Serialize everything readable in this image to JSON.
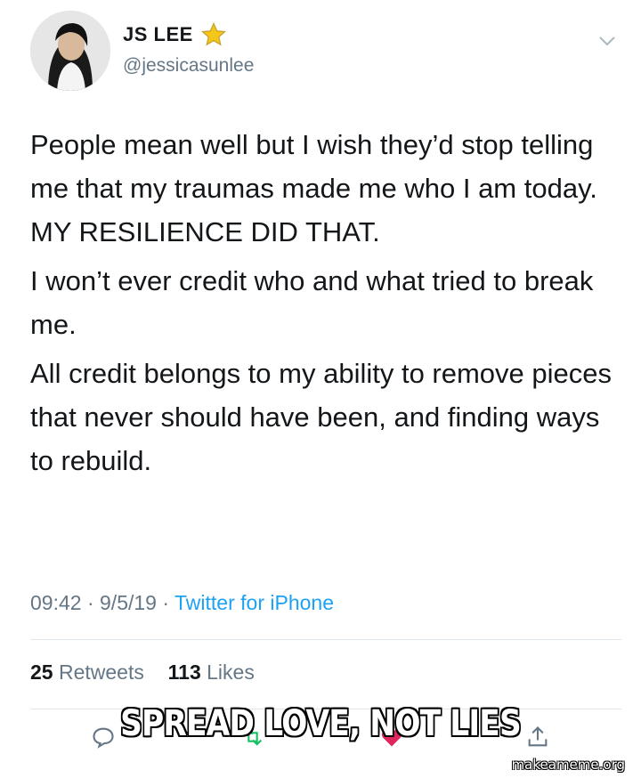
{
  "tweet": {
    "author": {
      "display_name": "JS LEE",
      "handle": "@jessicasunlee",
      "badge_icon": "star-icon",
      "avatar_icon": "avatar"
    },
    "menu_icon": "chevron-down-icon",
    "paragraphs": [
      "People mean well but I wish they’d stop telling me that my traumas made me who I am today. MY RESILIENCE DID THAT.",
      "I won’t ever credit who and what tried to break me.",
      "All credit belongs to my ability to remove pieces that never should have been, and finding ways to rebuild."
    ],
    "meta": {
      "time": "09:42",
      "date": "9/5/19",
      "separator": "·",
      "source": "Twitter for iPhone"
    },
    "stats": {
      "retweets_count": "25",
      "retweets_label": "Retweets",
      "likes_count": "113",
      "likes_label": "Likes"
    },
    "actions": [
      "reply-icon",
      "retweet-icon",
      "like-icon",
      "share-icon"
    ]
  },
  "meme": {
    "caption": "SPREAD LOVE, NOT LIES",
    "watermark": "makeameme.org"
  },
  "colors": {
    "text": "#14171a",
    "muted": "#657786",
    "link": "#1da1f2",
    "divider": "#e1e8ed",
    "star": "#f5c518"
  }
}
